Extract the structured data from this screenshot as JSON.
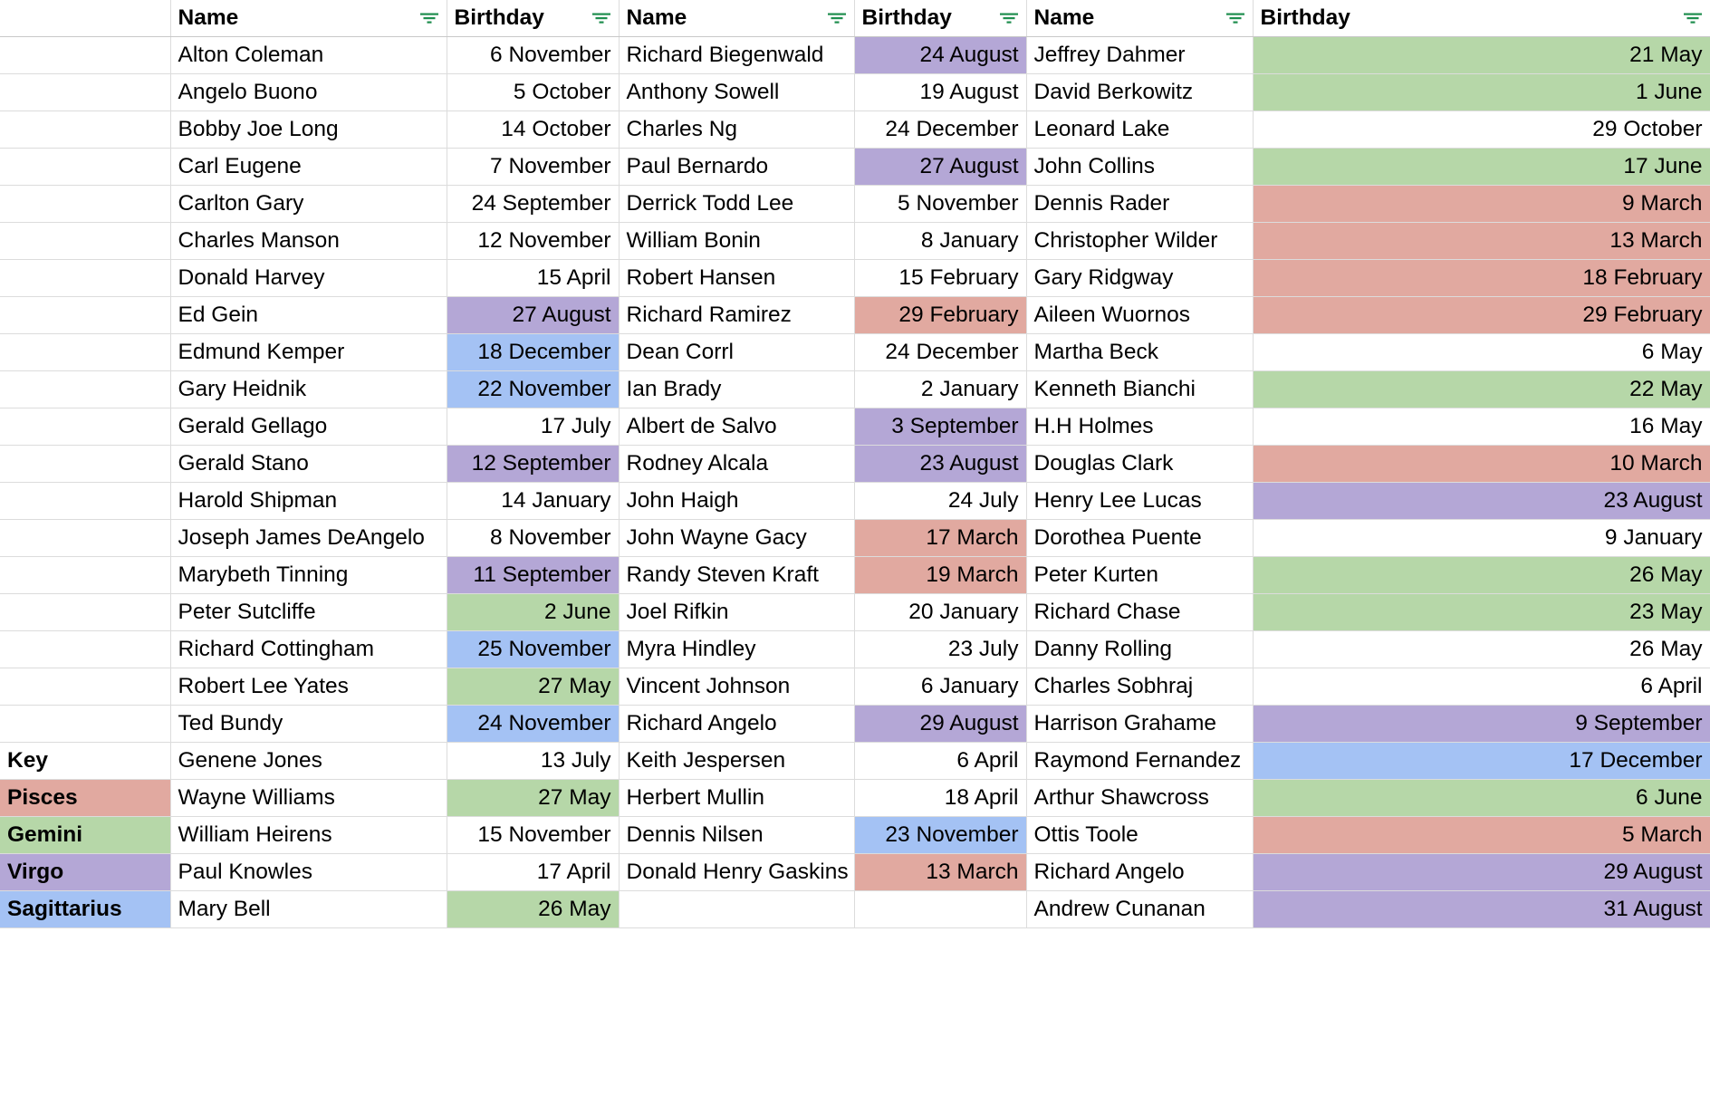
{
  "app": {
    "type": "spreadsheet",
    "icons": {
      "filter": "filter-icon"
    },
    "accent_color": "#34a853",
    "gridline_color": "#dcdcdc"
  },
  "headers": {
    "name": "Name",
    "birthday": "Birthday",
    "key": "Key"
  },
  "key_legend": {
    "title": "Key",
    "entries": [
      {
        "label": "Pisces",
        "color": "#e1a9a0",
        "sign": "pisces"
      },
      {
        "label": "Gemini",
        "color": "#b6d7a8",
        "sign": "gemini"
      },
      {
        "label": "Virgo",
        "color": "#b4a7d6",
        "sign": "virgo"
      },
      {
        "label": "Sagittarius",
        "color": "#a4c2f4",
        "sign": "sagittarius"
      }
    ]
  },
  "columns": [
    {
      "id": "group1",
      "name_header": "Name",
      "birthday_header": "Birthday"
    },
    {
      "id": "group2",
      "name_header": "Name",
      "birthday_header": "Birthday"
    },
    {
      "id": "group3",
      "name_header": "Name",
      "birthday_header": "Birthday"
    }
  ],
  "rows": [
    {
      "key": "",
      "g1": {
        "name": "Alton Coleman",
        "birthday": "6 November",
        "fill": "none"
      },
      "g2": {
        "name": "Richard Biegenwald",
        "birthday": "24 August",
        "fill": "virgo"
      },
      "g3": {
        "name": "Jeffrey Dahmer",
        "birthday": "21 May",
        "fill": "gemini"
      }
    },
    {
      "key": "",
      "g1": {
        "name": "Angelo Buono",
        "birthday": "5 October",
        "fill": "none"
      },
      "g2": {
        "name": "Anthony Sowell",
        "birthday": "19 August",
        "fill": "none"
      },
      "g3": {
        "name": "David Berkowitz",
        "birthday": "1 June",
        "fill": "gemini"
      }
    },
    {
      "key": "",
      "g1": {
        "name": "Bobby Joe Long",
        "birthday": "14 October",
        "fill": "none"
      },
      "g2": {
        "name": "Charles Ng",
        "birthday": "24 December",
        "fill": "none"
      },
      "g3": {
        "name": "Leonard Lake",
        "birthday": "29 October",
        "fill": "none"
      }
    },
    {
      "key": "",
      "g1": {
        "name": "Carl Eugene",
        "birthday": "7 November",
        "fill": "none"
      },
      "g2": {
        "name": "Paul Bernardo",
        "birthday": "27 August",
        "fill": "virgo"
      },
      "g3": {
        "name": "John Collins",
        "birthday": "17 June",
        "fill": "gemini"
      }
    },
    {
      "key": "",
      "g1": {
        "name": "Carlton Gary",
        "birthday": "24 September",
        "fill": "none"
      },
      "g2": {
        "name": "Derrick Todd Lee",
        "birthday": "5 November",
        "fill": "none"
      },
      "g3": {
        "name": "Dennis Rader",
        "birthday": "9 March",
        "fill": "pisces"
      }
    },
    {
      "key": "",
      "g1": {
        "name": "Charles Manson",
        "birthday": "12 November",
        "fill": "none"
      },
      "g2": {
        "name": "William Bonin",
        "birthday": "8 January",
        "fill": "none"
      },
      "g3": {
        "name": "Christopher Wilder",
        "birthday": "13 March",
        "fill": "pisces"
      }
    },
    {
      "key": "",
      "g1": {
        "name": "Donald Harvey",
        "birthday": "15 April",
        "fill": "none"
      },
      "g2": {
        "name": "Robert Hansen",
        "birthday": "15 February",
        "fill": "none"
      },
      "g3": {
        "name": "Gary Ridgway",
        "birthday": "18 February",
        "fill": "pisces"
      }
    },
    {
      "key": "",
      "g1": {
        "name": "Ed Gein",
        "birthday": "27 August",
        "fill": "virgo"
      },
      "g2": {
        "name": "Richard Ramirez",
        "birthday": "29 February",
        "fill": "pisces"
      },
      "g3": {
        "name": "Aileen Wuornos",
        "birthday": "29 February",
        "fill": "pisces"
      }
    },
    {
      "key": "",
      "g1": {
        "name": "Edmund Kemper",
        "birthday": "18 December",
        "fill": "sagittarius"
      },
      "g2": {
        "name": "Dean Corrl",
        "birthday": "24 December",
        "fill": "none"
      },
      "g3": {
        "name": "Martha Beck",
        "birthday": "6 May",
        "fill": "none"
      }
    },
    {
      "key": "",
      "g1": {
        "name": "Gary Heidnik",
        "birthday": "22 November",
        "fill": "sagittarius"
      },
      "g2": {
        "name": "Ian Brady",
        "birthday": "2 January",
        "fill": "none"
      },
      "g3": {
        "name": "Kenneth Bianchi",
        "birthday": "22 May",
        "fill": "gemini"
      }
    },
    {
      "key": "",
      "g1": {
        "name": "Gerald Gellago",
        "birthday": "17 July",
        "fill": "none"
      },
      "g2": {
        "name": "Albert de Salvo",
        "birthday": "3 September",
        "fill": "virgo"
      },
      "g3": {
        "name": "H.H Holmes",
        "birthday": "16 May",
        "fill": "none"
      }
    },
    {
      "key": "",
      "g1": {
        "name": "Gerald Stano",
        "birthday": "12 September",
        "fill": "virgo"
      },
      "g2": {
        "name": "Rodney Alcala",
        "birthday": "23 August",
        "fill": "virgo"
      },
      "g3": {
        "name": "Douglas Clark",
        "birthday": "10 March",
        "fill": "pisces"
      }
    },
    {
      "key": "",
      "g1": {
        "name": "Harold Shipman",
        "birthday": "14 January",
        "fill": "none"
      },
      "g2": {
        "name": "John Haigh",
        "birthday": "24 July",
        "fill": "none"
      },
      "g3": {
        "name": "Henry Lee Lucas",
        "birthday": "23 August",
        "fill": "virgo"
      }
    },
    {
      "key": "",
      "g1": {
        "name": "Joseph James DeAngelo",
        "birthday": "8 November",
        "fill": "none"
      },
      "g2": {
        "name": "John Wayne Gacy",
        "birthday": "17 March",
        "fill": "pisces"
      },
      "g3": {
        "name": "Dorothea Puente",
        "birthday": "9 January",
        "fill": "none"
      }
    },
    {
      "key": "",
      "g1": {
        "name": "Marybeth Tinning",
        "birthday": "11 September",
        "fill": "virgo"
      },
      "g2": {
        "name": "Randy Steven Kraft",
        "birthday": "19 March",
        "fill": "pisces"
      },
      "g3": {
        "name": "Peter Kurten",
        "birthday": "26 May",
        "fill": "gemini"
      }
    },
    {
      "key": "",
      "g1": {
        "name": "Peter Sutcliffe",
        "birthday": "2 June",
        "fill": "gemini"
      },
      "g2": {
        "name": "Joel Rifkin",
        "birthday": "20 January",
        "fill": "none"
      },
      "g3": {
        "name": "Richard Chase",
        "birthday": "23 May",
        "fill": "gemini"
      }
    },
    {
      "key": "",
      "g1": {
        "name": "Richard Cottingham",
        "birthday": "25 November",
        "fill": "sagittarius"
      },
      "g2": {
        "name": "Myra Hindley",
        "birthday": "23 July",
        "fill": "none"
      },
      "g3": {
        "name": "Danny Rolling",
        "birthday": "26 May",
        "fill": "none"
      }
    },
    {
      "key": "",
      "g1": {
        "name": "Robert Lee Yates",
        "birthday": "27 May",
        "fill": "gemini"
      },
      "g2": {
        "name": "Vincent Johnson",
        "birthday": "6 January",
        "fill": "none"
      },
      "g3": {
        "name": "Charles Sobhraj",
        "birthday": "6 April",
        "fill": "none"
      }
    },
    {
      "key": "",
      "g1": {
        "name": "Ted Bundy",
        "birthday": "24 November",
        "fill": "sagittarius"
      },
      "g2": {
        "name": "Richard Angelo",
        "birthday": "29 August",
        "fill": "virgo"
      },
      "g3": {
        "name": "Harrison Grahame",
        "birthday": "9 September",
        "fill": "virgo"
      }
    },
    {
      "key": "Key",
      "g1": {
        "name": "Genene Jones",
        "birthday": "13 July",
        "fill": "none"
      },
      "g2": {
        "name": "Keith Jespersen",
        "birthday": "6 April",
        "fill": "none"
      },
      "g3": {
        "name": "Raymond Fernandez",
        "birthday": "17 December",
        "fill": "sagittarius"
      }
    },
    {
      "key": "Pisces",
      "key_fill": "pisces",
      "g1": {
        "name": "Wayne Williams",
        "birthday": "27 May",
        "fill": "gemini"
      },
      "g2": {
        "name": "Herbert Mullin",
        "birthday": "18 April",
        "fill": "none"
      },
      "g3": {
        "name": "Arthur Shawcross",
        "birthday": "6 June",
        "fill": "gemini"
      }
    },
    {
      "key": "Gemini",
      "key_fill": "gemini",
      "g1": {
        "name": "William Heirens",
        "birthday": "15 November",
        "fill": "none"
      },
      "g2": {
        "name": "Dennis Nilsen",
        "birthday": "23 November",
        "fill": "sagittarius"
      },
      "g3": {
        "name": "Ottis Toole",
        "birthday": "5 March",
        "fill": "pisces"
      }
    },
    {
      "key": "Virgo",
      "key_fill": "virgo",
      "g1": {
        "name": "Paul Knowles",
        "birthday": "17 April",
        "fill": "none"
      },
      "g2": {
        "name": "Donald Henry Gaskins",
        "birthday": "13 March",
        "fill": "pisces"
      },
      "g3": {
        "name": "Richard Angelo",
        "birthday": "29 August",
        "fill": "virgo"
      }
    },
    {
      "key": "Sagittarius",
      "key_fill": "sagittarius",
      "g1": {
        "name": "Mary Bell",
        "birthday": "26 May",
        "fill": "gemini"
      },
      "g2": {
        "name": "",
        "birthday": "",
        "fill": "none"
      },
      "g3": {
        "name": "Andrew Cunanan",
        "birthday": "31 August",
        "fill": "virgo"
      }
    }
  ]
}
